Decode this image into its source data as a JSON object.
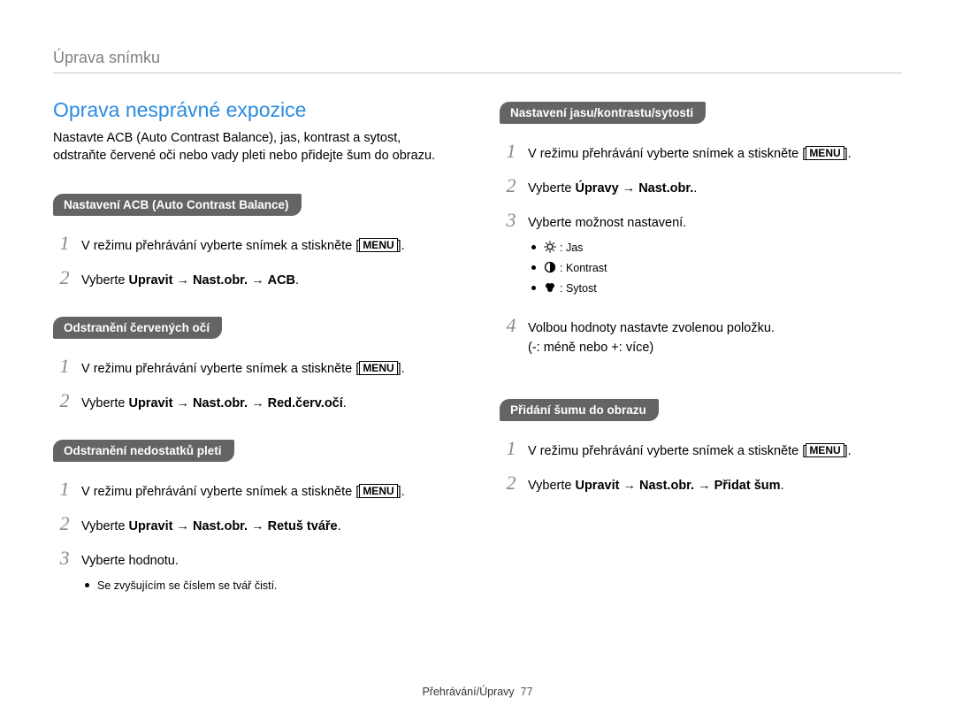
{
  "header": {
    "title": "Úprava snímku"
  },
  "main_title": "Oprava nesprávné expozice",
  "intro": "Nastavte ACB (Auto Contrast Balance), jas, kontrast a sytost, odstraňte červené oči nebo vady pleti nebo přidejte šum do obrazu.",
  "menu_label": "MENU",
  "arrow": "→",
  "left": {
    "acb": {
      "pill": "Nastavení ACB (Auto Contrast Balance)",
      "step1_pre": "V režimu přehrávání vyberte snímek a stiskněte [",
      "step1_post": "].",
      "step2_pre": "Vyberte ",
      "step2_b1": "Upravit",
      "step2_b2": "Nast.obr.",
      "step2_b3": "ACB",
      "step2_post": "."
    },
    "redeye": {
      "pill": "Odstranění červených očí",
      "step1_pre": "V režimu přehrávání vyberte snímek a stiskněte [",
      "step1_post": "].",
      "step2_pre": "Vyberte ",
      "step2_b1": "Upravit",
      "step2_b2": "Nast.obr.",
      "step2_b3": "Red.červ.očí",
      "step2_post": "."
    },
    "skin": {
      "pill": "Odstranění nedostatků pleti",
      "step1_pre": "V režimu přehrávání vyberte snímek a stiskněte [",
      "step1_post": "].",
      "step2_pre": "Vyberte ",
      "step2_b1": "Upravit",
      "step2_b2": "Nast.obr.",
      "step2_b3": "Retuš tváře",
      "step2_post": ".",
      "step3": "Vyberte hodnotu.",
      "bullet": "Se zvyšujícím se číslem se tvář čistí."
    }
  },
  "right": {
    "bcs": {
      "pill": "Nastavení jasu/kontrastu/sytosti",
      "step1_pre": "V režimu přehrávání vyberte snímek a stiskněte [",
      "step1_post": "].",
      "step2_pre": "Vyberte ",
      "step2_b1": "Úpravy",
      "step2_b2": "Nast.obr.",
      "step2_post": ".",
      "step3": "Vyberte možnost nastavení.",
      "opt_brightness": ": Jas",
      "opt_contrast": ": Kontrast",
      "opt_saturation": ": Sytost",
      "step4_l1": "Volbou hodnoty nastavte zvolenou položku.",
      "step4_l2": "(-: méně nebo +: více)"
    },
    "noise": {
      "pill": "Přidání šumu do obrazu",
      "step1_pre": "V režimu přehrávání vyberte snímek a stiskněte [",
      "step1_post": "].",
      "step2_pre": "Vyberte ",
      "step2_b1": "Upravit",
      "step2_b2": "Nast.obr.",
      "step2_b3": "Přidat šum",
      "step2_post": "."
    }
  },
  "footer": {
    "section": "Přehrávání/Úpravy",
    "page": "77"
  }
}
